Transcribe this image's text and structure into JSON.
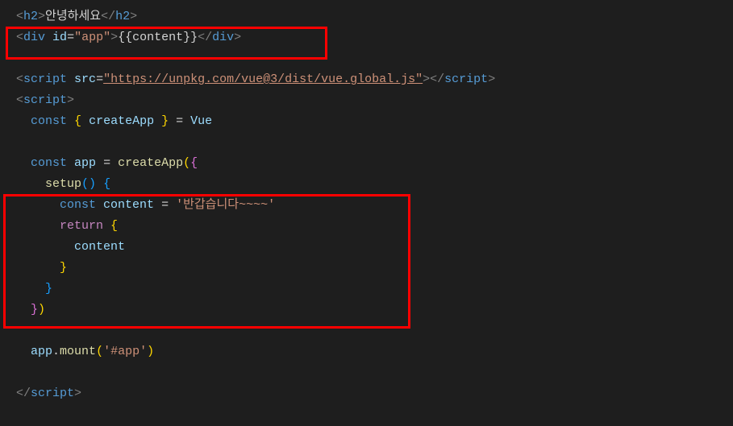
{
  "code": {
    "line1": {
      "tag": "h2",
      "text": "안녕하세요"
    },
    "line2": {
      "tag": "div",
      "attr": "id",
      "value": "\"app\"",
      "text": "{{content}}"
    },
    "line4": {
      "tag": "script",
      "attr": "src",
      "value": "\"https://unpkg.com/vue@3/dist/vue.global.js\""
    },
    "line5": {
      "tag": "script"
    },
    "line6": {
      "kw": "const",
      "var": "createApp",
      "eq": " = ",
      "obj": "Vue"
    },
    "line8": {
      "kw": "const",
      "var": "app",
      "eq": " = ",
      "fn": "createApp"
    },
    "line9": {
      "fn": "setup"
    },
    "line10": {
      "kw": "const",
      "var": "content",
      "eq": " = ",
      "str": "'반갑습니다~~~~'"
    },
    "line11": {
      "kw": "return"
    },
    "line12": {
      "var": "content"
    },
    "line17": {
      "var": "app",
      "fn": "mount",
      "str": "'#app'"
    },
    "line19": {
      "tag": "script"
    }
  }
}
